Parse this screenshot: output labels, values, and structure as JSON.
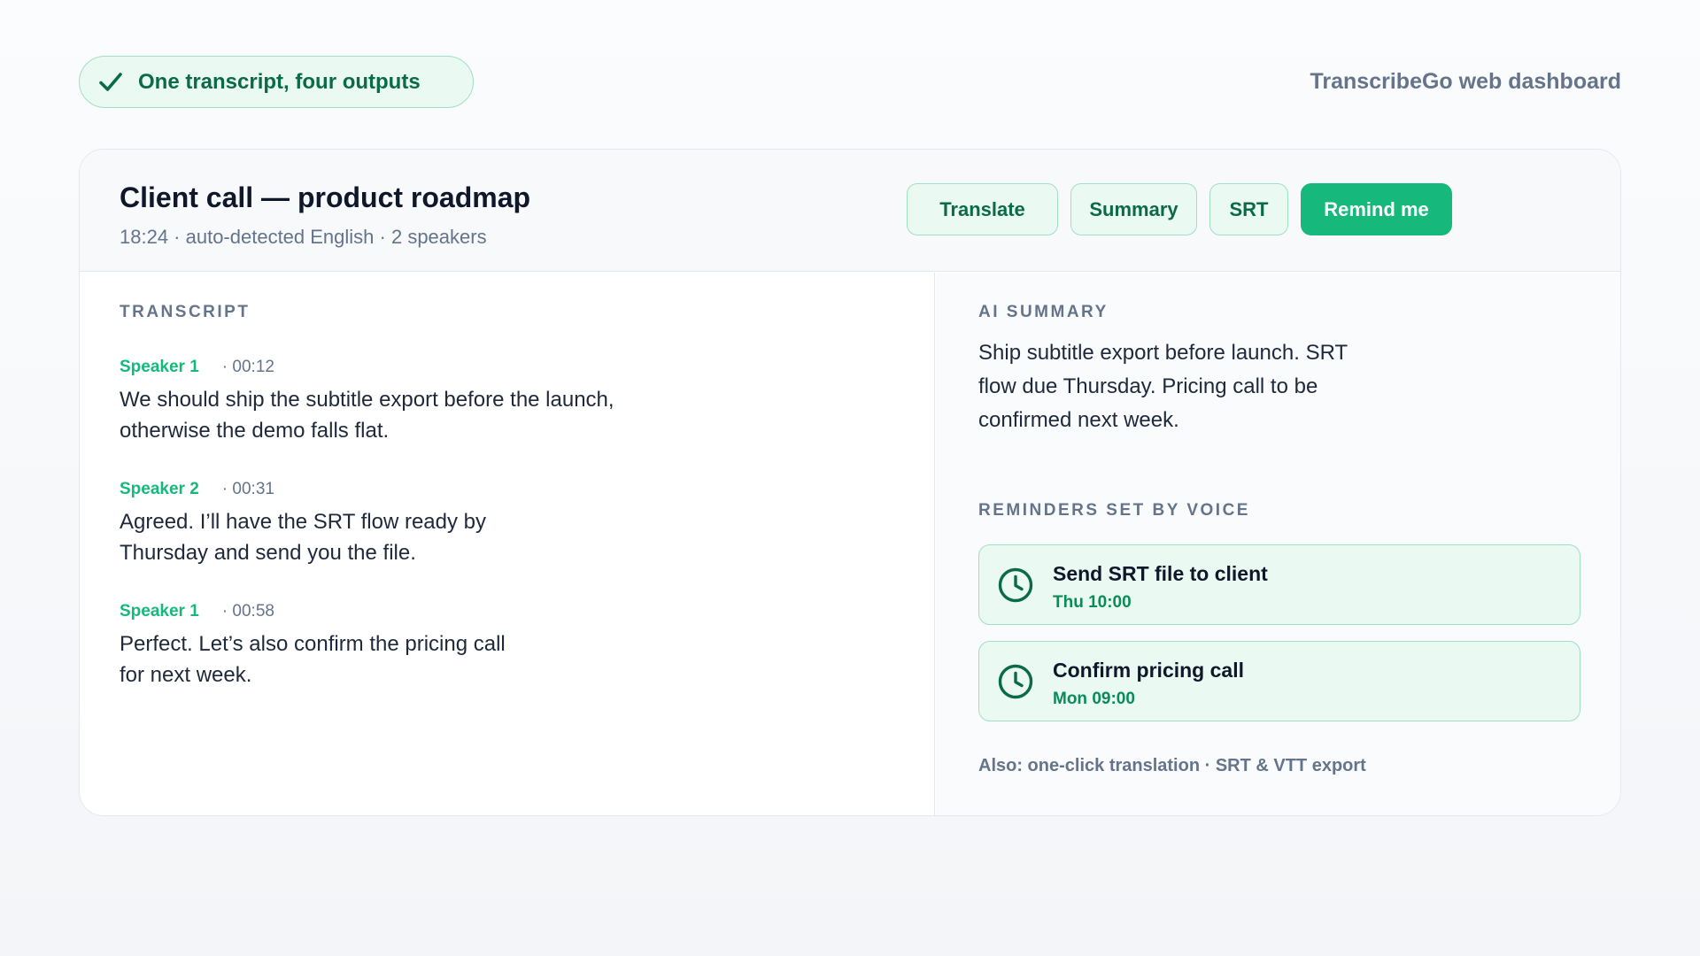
{
  "header": {
    "badge_label": "One transcript, four outputs",
    "brand": "TranscribeGo web dashboard"
  },
  "card": {
    "title": "Client call — product roadmap",
    "meta": "18:24 · auto-detected English · 2 speakers",
    "actions": {
      "translate": "Translate",
      "summary": "Summary",
      "srt": "SRT",
      "remind": "Remind me"
    }
  },
  "transcript": {
    "label": "TRANSCRIPT",
    "items": [
      {
        "speaker": "Speaker 1",
        "time": "· 00:12",
        "text": "We should ship the subtitle export before the launch, otherwise the demo falls flat."
      },
      {
        "speaker": "Speaker 2",
        "time": "· 00:31",
        "text": "Agreed. I’ll have the SRT flow ready by Thursday and send you the file."
      },
      {
        "speaker": "Speaker 1",
        "time": "· 00:58",
        "text": "Perfect. Let’s also confirm the pricing call for next week."
      }
    ]
  },
  "summary": {
    "label": "AI SUMMARY",
    "text": "Ship subtitle export before launch. SRT flow due Thursday. Pricing call to be confirmed next week."
  },
  "reminders": {
    "label": "REMINDERS SET BY VOICE",
    "items": [
      {
        "title": "Send SRT file to client",
        "time": "Thu 10:00",
        "icon": "clock-icon"
      },
      {
        "title": "Confirm pricing call",
        "time": "Mon 09:00",
        "icon": "clock-icon"
      }
    ]
  },
  "footnote": "Also: one-click translation · SRT & VTT export",
  "colors": {
    "accent": "#16b87c",
    "accent_dark": "#0b6b48",
    "accent_bg": "#eafaf2",
    "muted": "#64748b"
  }
}
